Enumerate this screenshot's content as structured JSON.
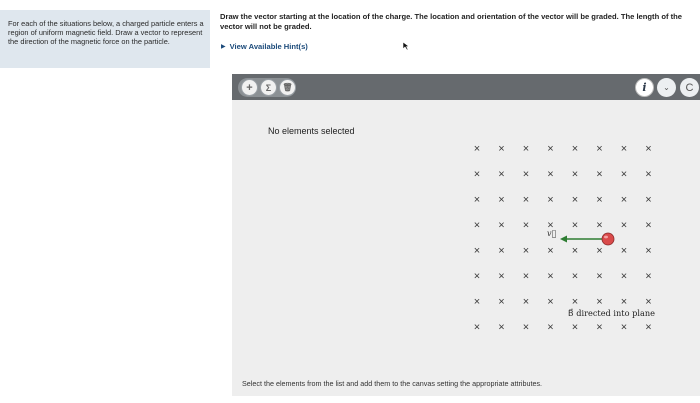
{
  "problem": {
    "prompt": "For each of the situations below, a charged particle enters a region of uniform magnetic field. Draw a vector to represent the direction of the magnetic force on the particle."
  },
  "instructions": {
    "text": "Draw the vector starting at the location of the charge. The location and orientation of the vector will be graded. The length of the vector will not be graded."
  },
  "hints": {
    "label": "View Available Hint(s)"
  },
  "toolbar": {
    "add_label": "+",
    "sum_label": "Σ",
    "delete_label": "🗑",
    "info_label": "i",
    "chevron_label": "⌄",
    "partial_label": "C"
  },
  "canvas": {
    "status": "No elements selected",
    "velocity_label": "v⃗",
    "field_label": "B⃗ directed into plane",
    "field_mark": "×",
    "footer": "Select the elements from the list and add them to the canvas setting the appropriate attributes."
  },
  "colors": {
    "charge": "#d94a4a",
    "velocity_arrow": "#2e7d32",
    "toolbar": "#666a6e",
    "canvas": "#eeeeee",
    "left_panel": "#dfe7ee"
  }
}
